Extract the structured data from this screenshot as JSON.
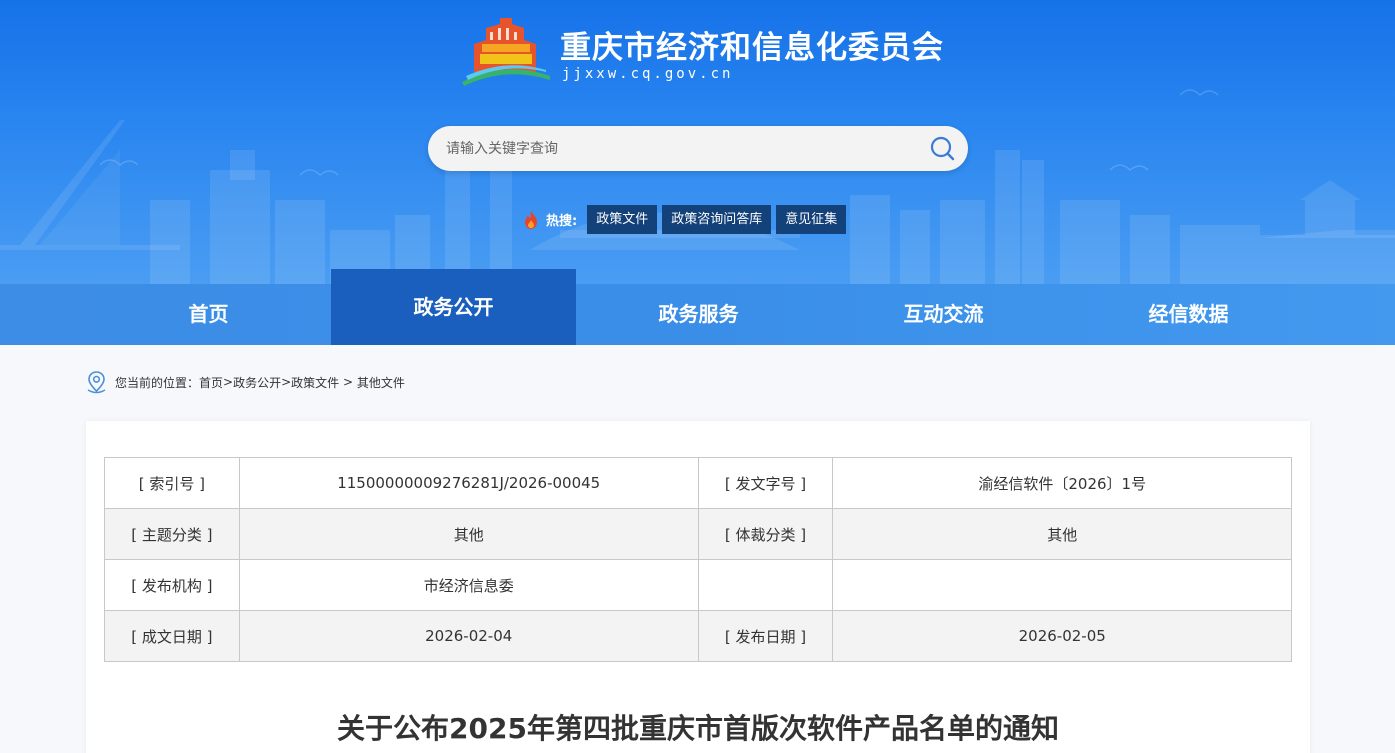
{
  "header": {
    "site_title": "重庆市经济和信息化委员会",
    "domain": "jjxxw.cq.gov.cn",
    "logo_icon": "chongqing-building-logo-icon"
  },
  "search": {
    "placeholder": "请输入关键字查询",
    "icon": "search-icon"
  },
  "hot_search": {
    "label": "热搜:",
    "icon": "flame-icon",
    "tags": [
      "政策文件",
      "政策咨询问答库",
      "意见征集"
    ]
  },
  "nav": {
    "items": [
      "首页",
      "政务公开",
      "政务服务",
      "互动交流",
      "经信数据"
    ],
    "active_index": 1
  },
  "breadcrumb": {
    "prefix": "您当前的位置：",
    "icon": "location-pin-icon",
    "items": [
      "首页",
      "政务公开",
      "政策文件",
      "其他文件"
    ],
    "separators": [
      ">",
      ">",
      " > "
    ]
  },
  "doc_meta": {
    "rows": [
      {
        "k1": "[ 索引号 ]",
        "v1": "11500000009276281J/2026-00045",
        "k2": "[ 发文字号 ]",
        "v2": "渝经信软件〔2026〕1号"
      },
      {
        "k1": "[ 主题分类 ]",
        "v1": "其他",
        "k2": "[ 体裁分类 ]",
        "v2": "其他"
      },
      {
        "k1": "[ 发布机构 ]",
        "v1": "市经济信息委",
        "k2": "",
        "v2": ""
      },
      {
        "k1": "[ 成文日期 ]",
        "v1": "2026-02-04",
        "k2": "[ 发布日期 ]",
        "v2": "2026-02-05"
      }
    ]
  },
  "document": {
    "title": "关于公布2025年第四批重庆市首版次软件产品名单的通知"
  },
  "colors": {
    "header_blue": "#1672e8",
    "nav_blue": "#3d8de6",
    "nav_active": "#1a5fbd",
    "hot_tag_bg": "#13417a"
  }
}
